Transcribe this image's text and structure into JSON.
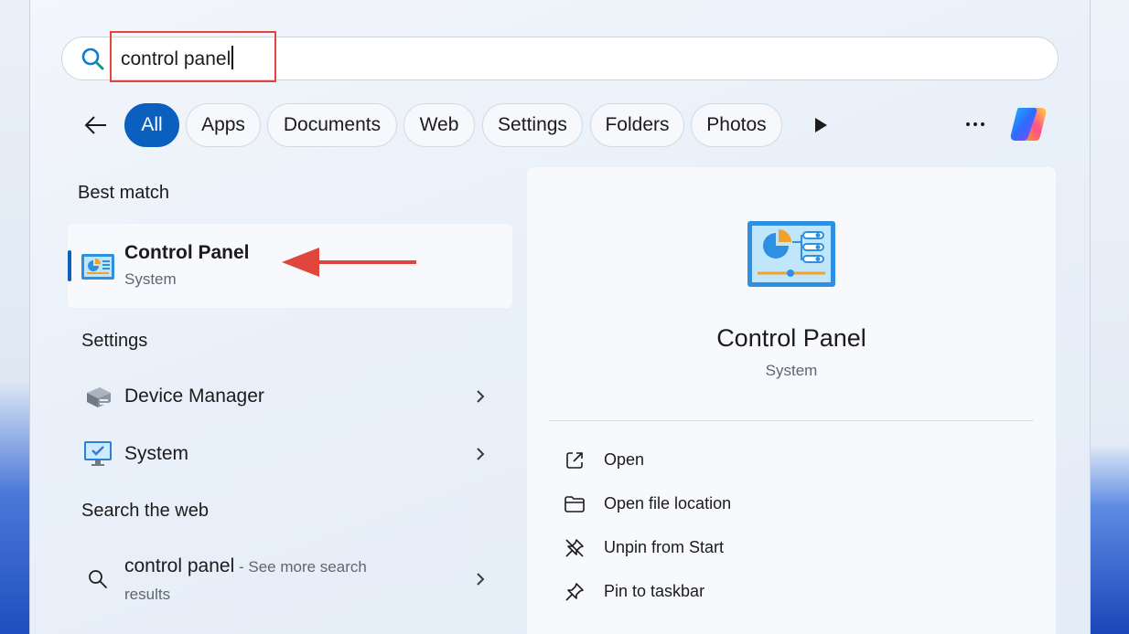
{
  "search": {
    "query": "control panel"
  },
  "filters": {
    "items": [
      "All",
      "Apps",
      "Documents",
      "Web",
      "Settings",
      "Folders",
      "Photos"
    ],
    "active": "All"
  },
  "results": {
    "best_match": {
      "heading": "Best match",
      "title": "Control Panel",
      "subtitle": "System"
    },
    "settings": {
      "heading": "Settings",
      "items": [
        {
          "label": "Device Manager"
        },
        {
          "label": "System"
        }
      ]
    },
    "web": {
      "heading": "Search the web",
      "query": "control panel",
      "suffix": " - See more search",
      "suffix2": "results"
    }
  },
  "detail": {
    "title": "Control Panel",
    "subtitle": "System",
    "actions": [
      {
        "label": "Open",
        "icon": "open-external-icon"
      },
      {
        "label": "Open file location",
        "icon": "folder-icon"
      },
      {
        "label": "Unpin from Start",
        "icon": "unpin-icon"
      },
      {
        "label": "Pin to taskbar",
        "icon": "pin-icon"
      }
    ]
  },
  "colors": {
    "accent": "#0a5fbf",
    "annotation": "#e0463c"
  }
}
